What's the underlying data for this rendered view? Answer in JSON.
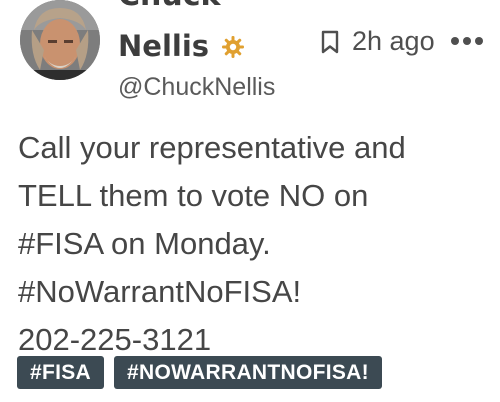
{
  "author": {
    "first_name_partial": "Chuck",
    "last_name": "Nellis",
    "handle": "@ChuckNellis",
    "badge_icon": "verified-badge-icon",
    "badge_color": "#e0a030"
  },
  "meta": {
    "time_ago": "2h ago",
    "bookmark_icon": "bookmark-icon",
    "more_icon": "more-options-icon"
  },
  "post": {
    "lines": [
      "Call your representative and",
      "TELL them to vote NO on",
      "#FISA on Monday.",
      "#NoWarrantNoFISA!",
      "202-225-3121"
    ]
  },
  "hashtags": [
    "#FISA",
    "#NOWARRANTNOFISA!"
  ],
  "colors": {
    "tag_background": "#3c4a53",
    "tag_text": "#ffffff",
    "body_text": "#464646"
  }
}
